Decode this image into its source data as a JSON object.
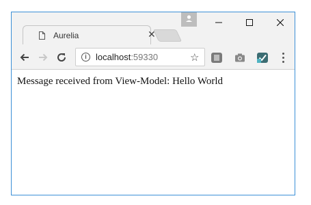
{
  "window": {
    "tab": {
      "title": "Aurelia",
      "close_glyph": "✕",
      "icon": "page-icon"
    },
    "controls": {
      "minimize": "—",
      "maximize": "☐",
      "close": "✕"
    }
  },
  "toolbar": {
    "back_glyph": "←",
    "forward_glyph": "→",
    "reload_glyph": "↻",
    "address": {
      "host": "localhost",
      "port": ":59330"
    },
    "star_glyph": "☆",
    "extensions": [
      "extension-icon",
      "camera-icon",
      "checkmark-extension-icon"
    ]
  },
  "page": {
    "message": "Message received from View-Model: Hello World"
  },
  "colors": {
    "window_border": "#3a8fd6",
    "chrome_bg": "#f2f2f2",
    "extension_teal": "#3c6d73"
  }
}
